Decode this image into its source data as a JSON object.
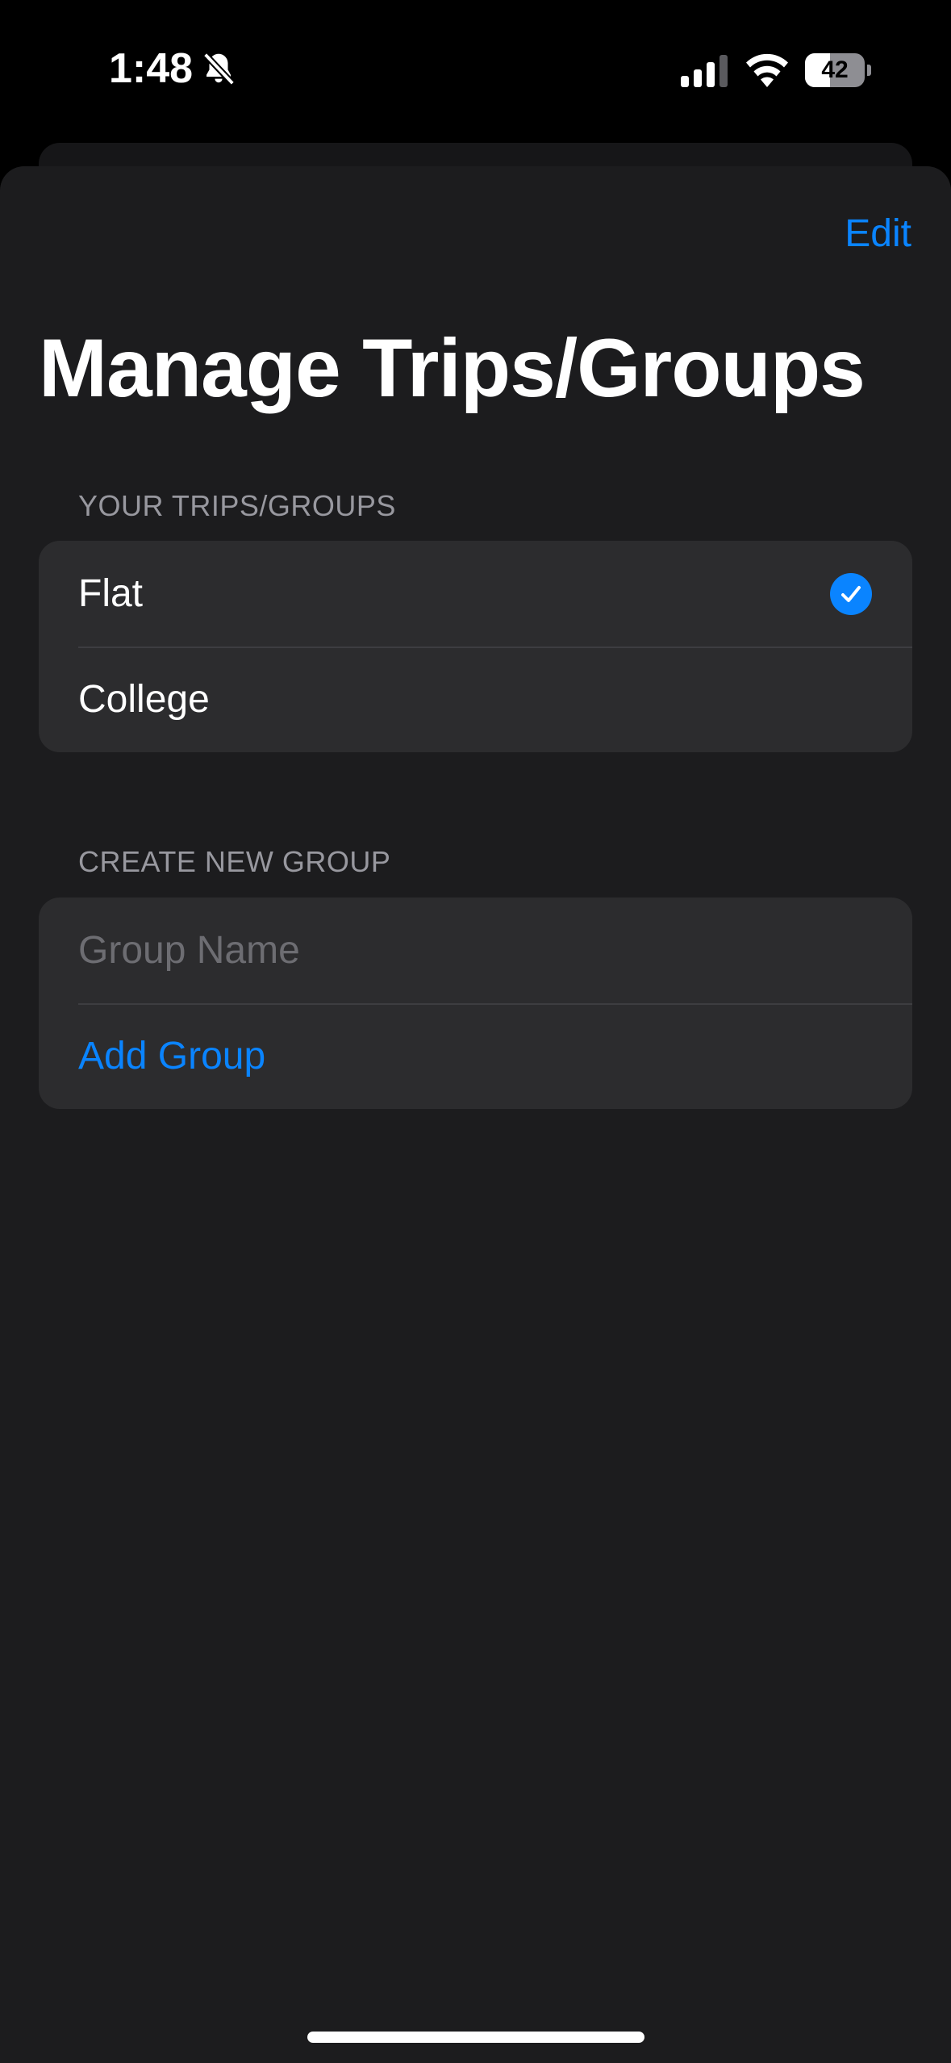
{
  "status_bar": {
    "time": "1:48",
    "battery_level": "42",
    "battery_fraction": 0.42,
    "icons": [
      "bell-slash-icon",
      "cellular-signal-icon",
      "wifi-icon",
      "battery-icon"
    ]
  },
  "header": {
    "edit_label": "Edit",
    "title": "Manage Trips/Groups"
  },
  "trips_section": {
    "header": "YOUR TRIPS/GROUPS",
    "items": [
      {
        "label": "Flat",
        "selected": true
      },
      {
        "label": "College",
        "selected": false
      }
    ]
  },
  "create_section": {
    "header": "CREATE NEW GROUP",
    "input_value": "",
    "input_placeholder": "Group Name",
    "add_label": "Add Group"
  },
  "colors": {
    "accent": "#0a84ff",
    "sheet_background": "#1c1c1e",
    "card_background": "#2c2c2e",
    "secondary_text": "#98989f"
  }
}
